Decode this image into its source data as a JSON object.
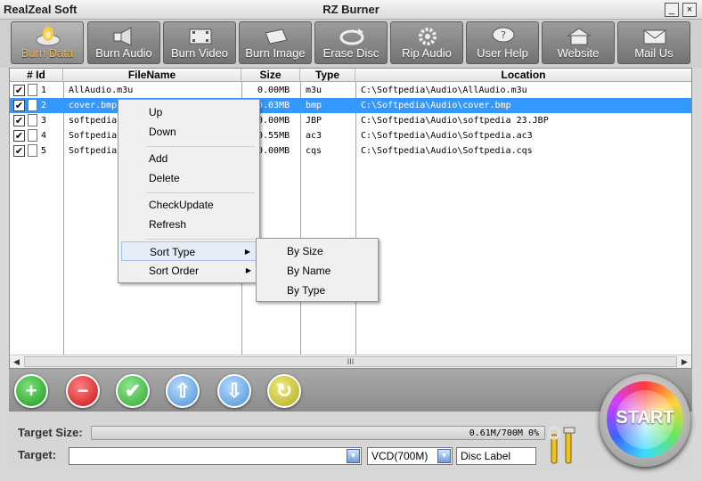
{
  "window": {
    "app_name": "RealZeal Soft",
    "title": "RZ Burner",
    "minimize": "_",
    "close": "×"
  },
  "toolbar": [
    {
      "label": "Burn Data",
      "icon": "disc-burn-icon",
      "active": true
    },
    {
      "label": "Burn Audio",
      "icon": "speaker-icon"
    },
    {
      "label": "Burn Video",
      "icon": "film-icon"
    },
    {
      "label": "Burn Image",
      "icon": "image-disc-icon"
    },
    {
      "label": "Erase Disc",
      "icon": "erase-icon"
    },
    {
      "label": "Rip Audio",
      "icon": "gear-icon"
    },
    {
      "label": "User Help",
      "icon": "help-icon"
    },
    {
      "label": "Website",
      "icon": "house-icon"
    },
    {
      "label": "Mail Us",
      "icon": "mail-icon"
    }
  ],
  "file_list": {
    "columns": [
      "# Id",
      "FileName",
      "Size",
      "Type",
      "Location"
    ],
    "rows": [
      {
        "id": "1",
        "name": "AllAudio.m3u",
        "size": "0.00MB",
        "type": "m3u",
        "location": "C:\\Softpedia\\Audio\\AllAudio.m3u",
        "checked": true,
        "selected": false
      },
      {
        "id": "2",
        "name": "cover.bmp",
        "size": "0.03MB",
        "type": "bmp",
        "location": "C:\\Softpedia\\Audio\\cover.bmp",
        "checked": true,
        "selected": true
      },
      {
        "id": "3",
        "name": "softpedia",
        "size": "0.00MB",
        "type": "JBP",
        "location": "C:\\Softpedia\\Audio\\softpedia 23.JBP",
        "checked": true,
        "selected": false
      },
      {
        "id": "4",
        "name": "Softpedia",
        "size": "0.55MB",
        "type": "ac3",
        "location": "C:\\Softpedia\\Audio\\Softpedia.ac3",
        "checked": true,
        "selected": false
      },
      {
        "id": "5",
        "name": "Softpedia",
        "size": "0.00MB",
        "type": "cqs",
        "location": "C:\\Softpedia\\Audio\\Softpedia.cqs",
        "checked": true,
        "selected": false
      }
    ],
    "scroll_grip": "III"
  },
  "context_menu": {
    "items": [
      {
        "label": "Up"
      },
      {
        "label": "Down"
      },
      {
        "label": "Add"
      },
      {
        "label": "Delete"
      },
      {
        "label": "CheckUpdate"
      },
      {
        "label": "Refresh"
      },
      {
        "label": "Sort Type",
        "submenu": true,
        "hover": true
      },
      {
        "label": "Sort Order",
        "submenu": true
      }
    ],
    "submenu": [
      "By Size",
      "By Name",
      "By Type"
    ]
  },
  "bottom": {
    "target_size_label": "Target Size:",
    "target_size_text": "0.61M/700M  0%",
    "progress_fraction": 0.0,
    "target_label": "Target:",
    "target_value": "",
    "media_value": "VCD(700M)",
    "disc_label": "Disc Label",
    "start_label": "START"
  },
  "colors": {
    "selection": "#3399ff",
    "active_tab_text": "#ffb43a"
  }
}
